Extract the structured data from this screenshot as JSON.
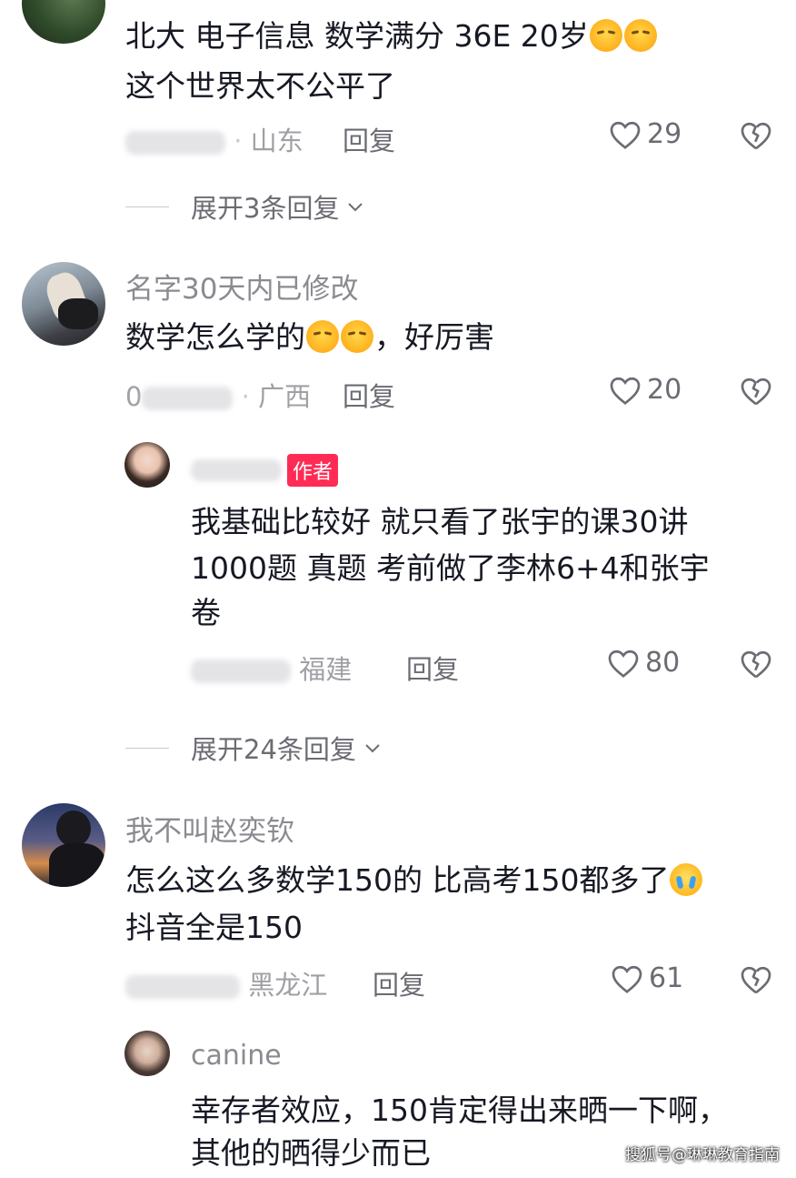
{
  "comments": [
    {
      "text_line1": "北大 电子信息 数学满分 36E 20岁",
      "text_line2": "这个世界太不公平了",
      "location": "山东",
      "reply_label": "回复",
      "likes": "29",
      "emoji_1": "grimace-emoji",
      "emoji_2": "grimace-emoji"
    },
    {
      "username": "名字30天内已修改",
      "text_prefix": "数学怎么学的",
      "text_suffix": "，好厉害",
      "date_fragment": "0",
      "location": "广西",
      "reply_label": "回复",
      "likes": "20",
      "emoji_1": "grimace-emoji",
      "emoji_2": "grimace-emoji"
    },
    {
      "username": "我不叫赵奕钦",
      "text_line1": "怎么这么多数学150的 比高考150都多了",
      "text_line2": "抖音全是150",
      "location": "黑龙江",
      "reply_label": "回复",
      "likes": "61",
      "emoji_1": "laugh-cry-emoji"
    }
  ],
  "replies": [
    {
      "author_badge": "作者",
      "text_line1": "我基础比较好 就只看了张宇的课30讲",
      "text_line2": "1000题 真题 考前做了李林6+4和张宇",
      "text_line3": "卷",
      "location": "福建",
      "reply_label": "回复",
      "likes": "80"
    },
    {
      "username": "canine",
      "text_line1": "幸存者效应，150肯定得出来晒一下啊，",
      "text_line2": "其他的晒得少而已"
    }
  ],
  "expand_1": "展开3条回复",
  "expand_2": "展开24条回复",
  "watermark": "搜狐号@琳琳教育指南",
  "icons": {
    "like": "heart-outline-icon",
    "dislike": "broken-heart-icon",
    "expand": "chevron-down-icon"
  },
  "colors": {
    "author_badge": "#fe2c55",
    "meta_text": "#9fa0a5",
    "body_text": "#161823"
  }
}
